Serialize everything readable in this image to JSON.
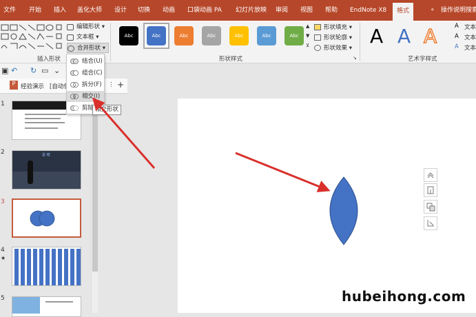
{
  "ribbon_tabs": [
    "文件",
    "开始",
    "插入",
    "盖化大师",
    "设计",
    "切换",
    "动画",
    "口袋动画 PA",
    "幻灯片放映",
    "审阅",
    "视图",
    "帮助",
    "EndNote X8",
    "格式",
    "操作说明搜索"
  ],
  "active_tab": "格式",
  "insert_shapes": {
    "group_label": "插入形状",
    "edit_shape": "编辑形状",
    "text_box": "文本框",
    "merge_shapes": "合并形状"
  },
  "merge_menu": {
    "items": [
      "结合(U)",
      "组合(C)",
      "拆分(F)",
      "相交(I)",
      "剪除(S)"
    ],
    "highlighted": "相交(I)",
    "tooltip": "相交形状"
  },
  "shape_styles": {
    "group_label": "形状样式",
    "swatch_text": "Abc",
    "swatch_colors": [
      "#000000",
      "#4472c4",
      "#ed7d31",
      "#a5a5a5",
      "#ffc000",
      "#5b9bd5",
      "#70ad47"
    ],
    "fill": "形状填充",
    "outline": "形状轮廓",
    "effects": "形状效果"
  },
  "wordart": {
    "group_label": "艺术字样式",
    "sample": "A",
    "text_fill": "文本",
    "text_outline": "文本",
    "text_effects": "文本"
  },
  "doc_tabs": {
    "tab1": "经验演示",
    "tab2": "[自动保"
  },
  "slides": [
    {
      "num": "1",
      "current": false
    },
    {
      "num": "2",
      "current": false,
      "title": "总 结"
    },
    {
      "num": "3",
      "current": true
    },
    {
      "num": "4",
      "current": false,
      "mark": "★"
    },
    {
      "num": "5",
      "current": false
    }
  ],
  "canvas_shape_color": "#4472c4",
  "accent_red": "#d9302c",
  "watermark": "hubeihong.com"
}
